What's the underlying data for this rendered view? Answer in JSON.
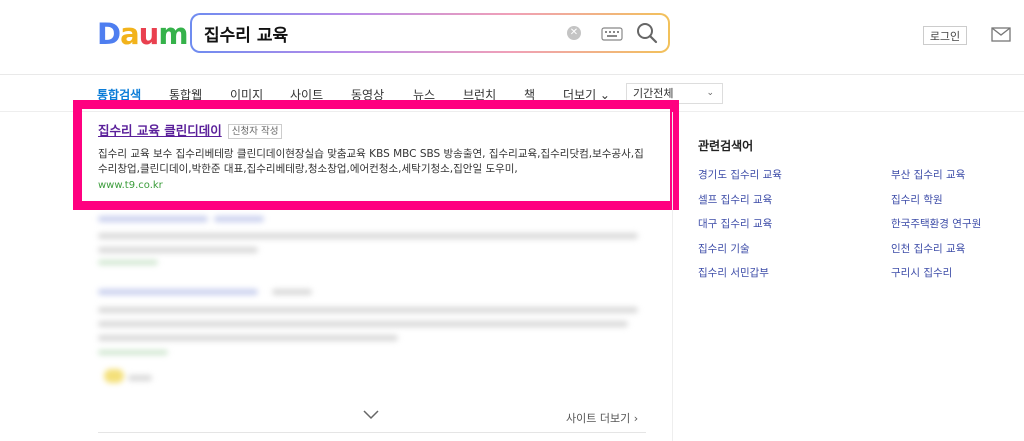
{
  "logo": {
    "text": "Daum",
    "letters": [
      {
        "ch": "D",
        "color": "#4e7ef0"
      },
      {
        "ch": "a",
        "color": "#f2b31b"
      },
      {
        "ch": "u",
        "color": "#e9404f"
      },
      {
        "ch": "m",
        "color": "#35b24a"
      }
    ]
  },
  "search": {
    "value": "집수리 교육"
  },
  "header": {
    "login_label": "로그인"
  },
  "nav": {
    "tabs": [
      {
        "label": "통합검색",
        "active": true
      },
      {
        "label": "통합웹"
      },
      {
        "label": "이미지"
      },
      {
        "label": "사이트"
      },
      {
        "label": "동영상"
      },
      {
        "label": "뉴스"
      },
      {
        "label": "브런치"
      },
      {
        "label": "책"
      },
      {
        "label": "더보기 ⌄"
      }
    ],
    "period": "기간전체"
  },
  "result": {
    "title": "집수리 교육 클린디데이",
    "badge": "신청자 작성",
    "description": "집수리 교육 보수 집수리베테랑 클린디데이현장실습 맞춤교육 KBS MBC SBS 방송출연, 집수리교육,집수리닷컴,보수공사,집수리창업,클린디데이,박한준 대표,집수리베테랑,청소창업,에어컨청소,세탁기청소,집안일 도우미,",
    "url": "www.t9.co.kr"
  },
  "site_more": "사이트 더보기 ›",
  "related": {
    "title": "관련검색어",
    "left": [
      "경기도 집수리 교육",
      "셀프 집수리 교육",
      "대구 집수리 교육",
      "집수리 기술",
      "집수리 서민갑부"
    ],
    "right": [
      "부산 집수리 교육",
      "집수리 학원",
      "한국주택환경 연구원",
      "인천 집수리 교육",
      "구리시 집수리"
    ]
  },
  "colors": {
    "accent": "#0a7cd8",
    "highlight": "#ff0080",
    "link_visited": "#5a1f9a",
    "url": "#3c9d3c"
  }
}
